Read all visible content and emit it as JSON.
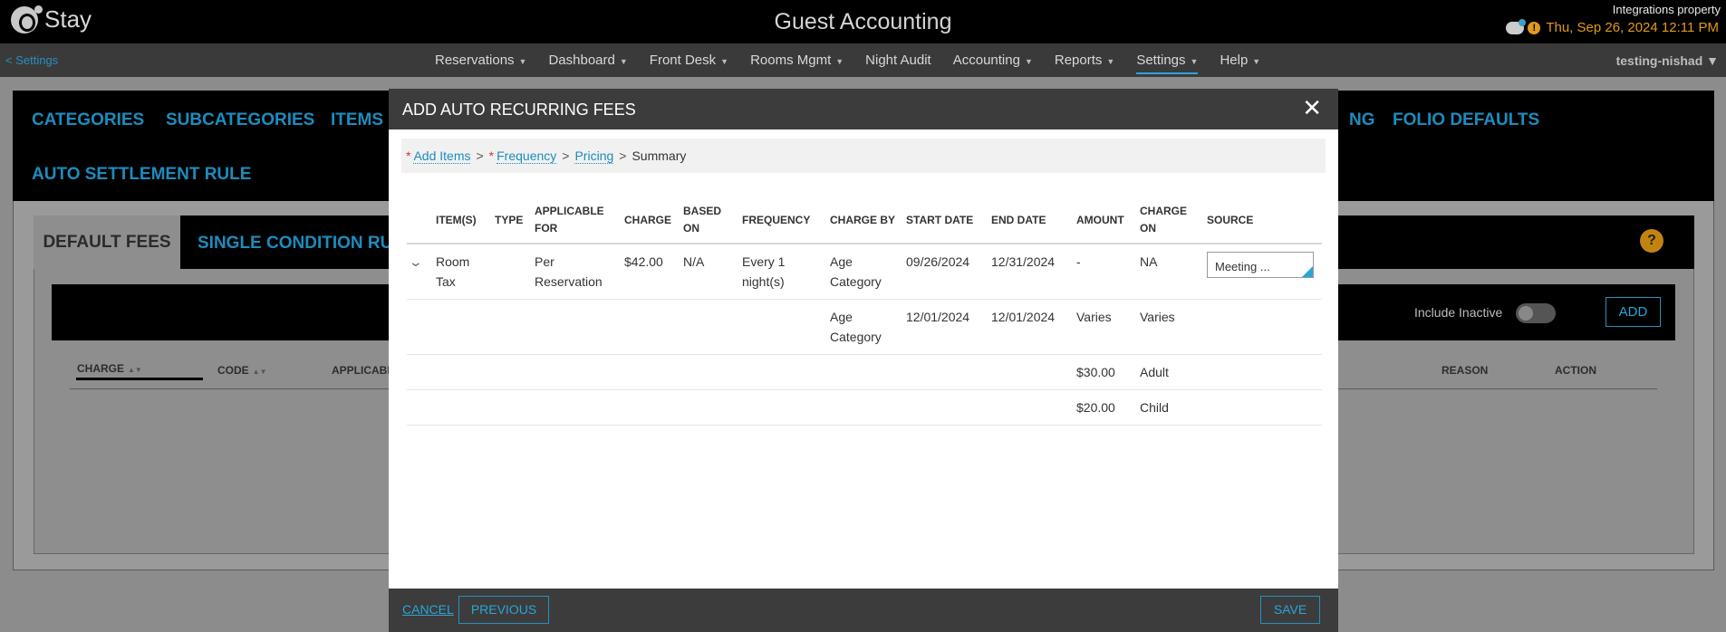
{
  "header": {
    "logo_text": "Stay",
    "app_title": "Guest Accounting",
    "property_name": "Integrations property",
    "datetime": "Thu, Sep 26, 2024 12:11 PM",
    "warning_badge": "!"
  },
  "nav": {
    "back_label": "<  Settings",
    "items": [
      {
        "label": "Reservations",
        "caret": "▼"
      },
      {
        "label": "Dashboard",
        "caret": "▼"
      },
      {
        "label": "Front Desk",
        "caret": "▼"
      },
      {
        "label": "Rooms Mgmt",
        "caret": "▼"
      },
      {
        "label": "Night Audit",
        "caret": ""
      },
      {
        "label": "Accounting",
        "caret": "▼"
      },
      {
        "label": "Reports",
        "caret": "▼"
      },
      {
        "label": "Settings",
        "caret": "▼"
      },
      {
        "label": "Help",
        "caret": "▼"
      }
    ],
    "active": "Settings",
    "user": "testing-nishad ▼"
  },
  "categories": {
    "tabs": [
      "CATEGORIES",
      "SUBCATEGORIES",
      "ITEMS",
      "NG",
      "FOLIO DEFAULTS",
      "AUTO SETTLEMENT RULE"
    ]
  },
  "subtabs": {
    "default": "DEFAULT FEES",
    "single": "SINGLE CONDITION RULE"
  },
  "underlay": {
    "include_inactive": "Include Inactive",
    "add_label": "ADD",
    "help": "?",
    "columns": {
      "charge": "CHARGE",
      "code": "CODE",
      "applicable": "APPLICABLE",
      "reason": "REASON",
      "action": "ACTION"
    }
  },
  "modal": {
    "title": "ADD AUTO RECURRING FEES",
    "close": "✕",
    "wizard": {
      "required_mark": "*",
      "step1": "Add Items",
      "step2": "Frequency",
      "step3": "Pricing",
      "step4": "Summary",
      "separator": ">"
    },
    "table": {
      "headers": {
        "items": "ITEM(S)",
        "type": "TYPE",
        "applicable_for": "APPLICABLE FOR",
        "charge": "CHARGE",
        "based_on": "BASED ON",
        "frequency": "FREQUENCY",
        "charge_by": "CHARGE BY",
        "start_date": "START DATE",
        "end_date": "END DATE",
        "amount": "AMOUNT",
        "charge_on": "CHARGE ON",
        "source": "SOURCE"
      },
      "main_row": {
        "item": "Room Tax",
        "type": "",
        "applicable_for": "Per Reservation",
        "charge": "$42.00",
        "based_on": "N/A",
        "frequency": "Every 1 night(s)",
        "charge_by": "Age Category",
        "start_date": "09/26/2024",
        "end_date": "12/31/2024",
        "amount": "-",
        "charge_on": "NA",
        "source": "Meeting ..."
      },
      "sub_row": {
        "charge_by": "Age Category",
        "start_date": "12/01/2024",
        "end_date": "12/01/2024",
        "amount": "Varies",
        "charge_on": "Varies"
      },
      "price_rows": [
        {
          "amount": "$30.00",
          "charge_on": "Adult"
        },
        {
          "amount": "$20.00",
          "charge_on": "Child"
        }
      ]
    },
    "footer": {
      "cancel": "CANCEL",
      "previous": "PREVIOUS",
      "save": "SAVE"
    }
  }
}
